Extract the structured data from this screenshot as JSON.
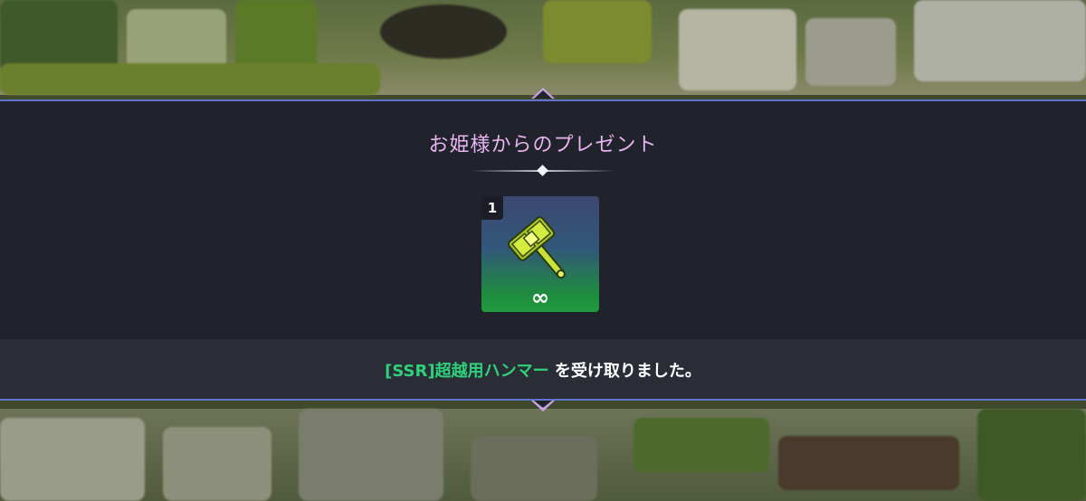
{
  "dialog": {
    "title": "お姫様からのプレゼント",
    "item": {
      "quantity": "1",
      "icon": "hammer-icon",
      "duration": "∞"
    },
    "message": {
      "item_name": "[SSR]超越用ハンマー",
      "suffix": "を受け取りました。"
    }
  },
  "colors": {
    "title": "#e7b4ef",
    "item_name": "#2fd07a",
    "panel": "#20232b",
    "border": "#5f73c9"
  }
}
